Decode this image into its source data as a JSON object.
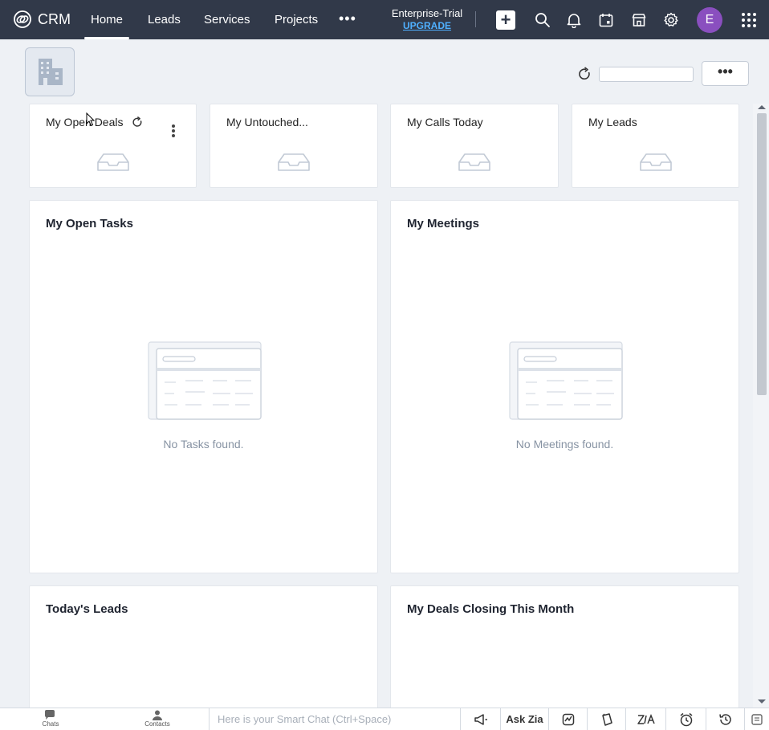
{
  "app": {
    "name": "CRM"
  },
  "nav": {
    "tabs": [
      {
        "label": "Home",
        "active": true
      },
      {
        "label": "Leads"
      },
      {
        "label": "Services"
      },
      {
        "label": "Projects"
      }
    ],
    "more_label": "•••",
    "edition": "Enterprise-Trial",
    "upgrade": "UPGRADE",
    "avatar_initial": "E"
  },
  "header": {
    "more_label": "•••",
    "search_value": ""
  },
  "widgets": {
    "row1": [
      {
        "title": "My Open Deals"
      },
      {
        "title": "My Untouched..."
      },
      {
        "title": "My Calls Today"
      },
      {
        "title": "My Leads"
      }
    ],
    "tasks": {
      "title": "My Open Tasks",
      "empty": "No Tasks found."
    },
    "meetings": {
      "title": "My Meetings",
      "empty": "No Meetings found."
    },
    "todays_leads": {
      "title": "Today's Leads"
    },
    "deals_closing": {
      "title": "My Deals Closing This Month"
    }
  },
  "bottombar": {
    "chats": "Chats",
    "contacts": "Contacts",
    "smart_chat_placeholder": "Here is your Smart Chat (Ctrl+Space)",
    "ask_zia": "Ask Zia"
  },
  "colors": {
    "topbar": "#313949",
    "avatar": "#8a4fbf",
    "upgrade": "#4fb0ff"
  },
  "icons": [
    "crm-logo-icon",
    "add-icon",
    "search-icon",
    "bell-icon",
    "calendar-icon",
    "marketplace-icon",
    "settings-icon",
    "apps-grid-icon",
    "refresh-icon",
    "kebab-icon",
    "inbox-icon",
    "chat-icon",
    "contacts-icon",
    "announce-icon",
    "signals-icon",
    "notes-icon",
    "zia-icon",
    "alarm-icon",
    "history-icon",
    "feedback-icon"
  ]
}
